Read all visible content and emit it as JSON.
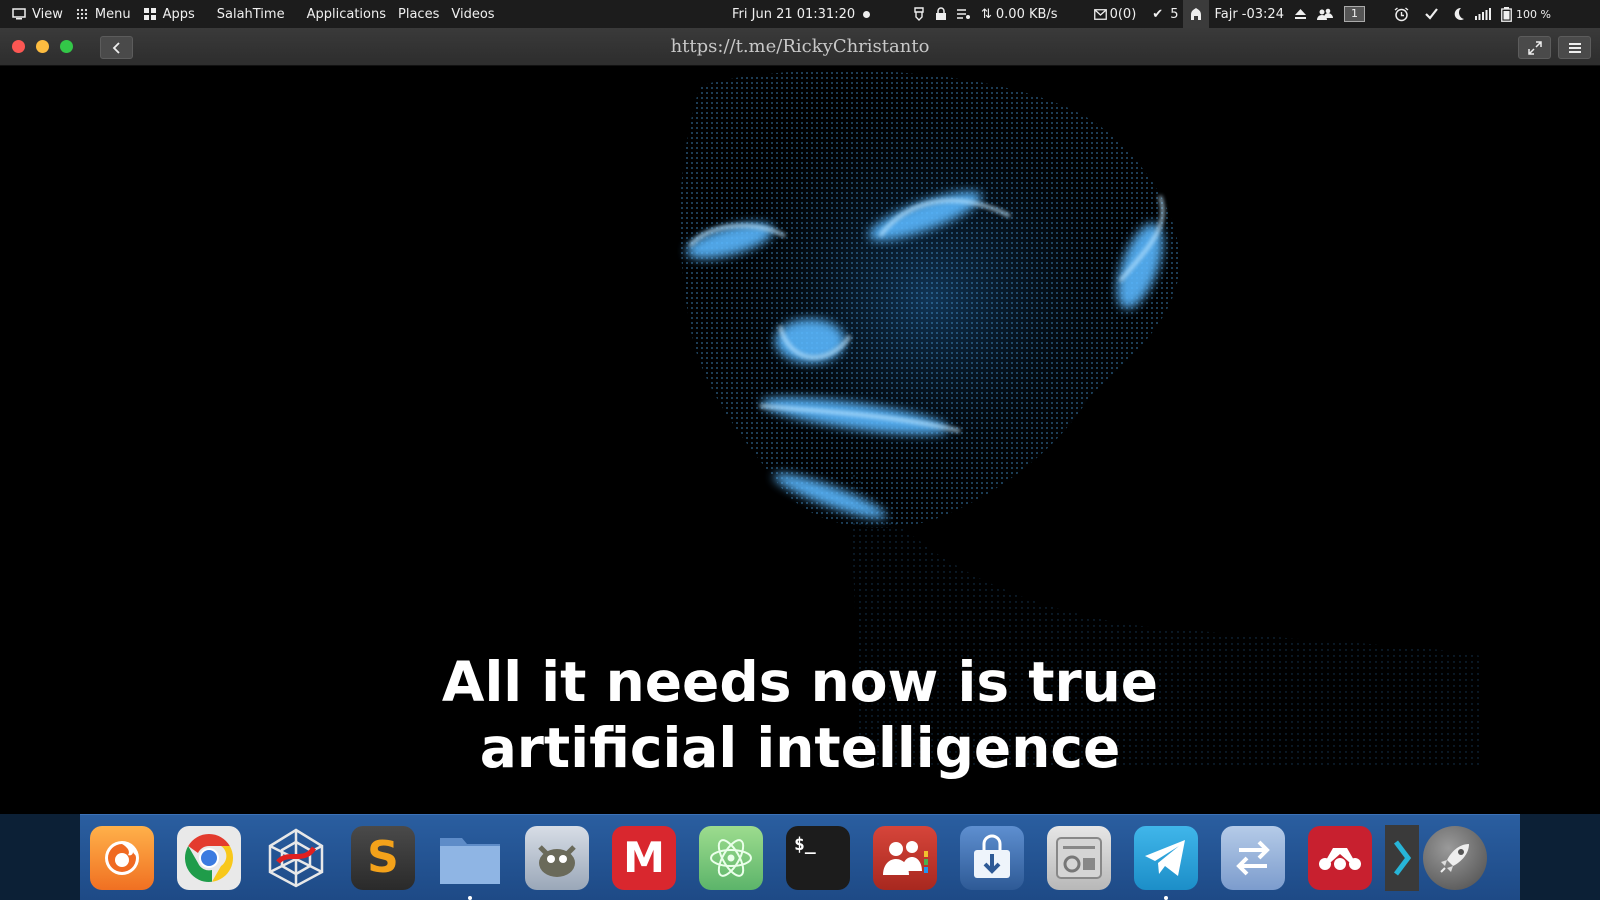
{
  "top_panel": {
    "left_items": [
      {
        "icon": "window-switch-icon",
        "label": "View"
      },
      {
        "icon": "grid-dots-icon",
        "label": "Menu"
      },
      {
        "icon": "apps-grid-icon",
        "label": "Apps"
      },
      {
        "icon": "",
        "label": "SalahTime"
      },
      {
        "icon": "",
        "label": "Applications"
      },
      {
        "icon": "",
        "label": "Places"
      },
      {
        "icon": "",
        "label": "Videos"
      }
    ],
    "datetime": "Fri Jun 21  01:31:20",
    "net_speed": "0.00 KB/s",
    "mail_count": "0(0)",
    "tasks_count": "5",
    "prayer": "Fajr -03:24",
    "workspace": "1",
    "battery": "100 %"
  },
  "window": {
    "url": "https://t.me/RickyChristanto"
  },
  "subtitle": {
    "line1": "All it needs now is true",
    "line2": "artificial intelligence"
  },
  "dock": {
    "apps": [
      {
        "name": "firefox",
        "color": "#f08a24"
      },
      {
        "name": "chrome",
        "color": "#e0e0e0"
      },
      {
        "name": "spider",
        "color": "#2f5a90"
      },
      {
        "name": "sublime-text",
        "color": "#3b3b3b"
      },
      {
        "name": "files",
        "color": "#7aa4d6"
      },
      {
        "name": "gimp",
        "color": "#b8c4d2"
      },
      {
        "name": "mega",
        "color": "#d9272e"
      },
      {
        "name": "atom",
        "color": "#7ccc7c"
      },
      {
        "name": "terminal",
        "color": "#1e1e1e"
      },
      {
        "name": "contacts",
        "color": "#c0392b"
      },
      {
        "name": "downloader",
        "color": "#3f6fa8"
      },
      {
        "name": "system-monitor",
        "color": "#c9c9c9"
      },
      {
        "name": "telegram",
        "color": "#2ea6da"
      },
      {
        "name": "transfer",
        "color": "#8fb0d8"
      },
      {
        "name": "mendeley",
        "color": "#c8202f"
      },
      {
        "name": "launcher",
        "color": "#6f6f6f"
      }
    ],
    "terminal_prompt": "$_"
  }
}
